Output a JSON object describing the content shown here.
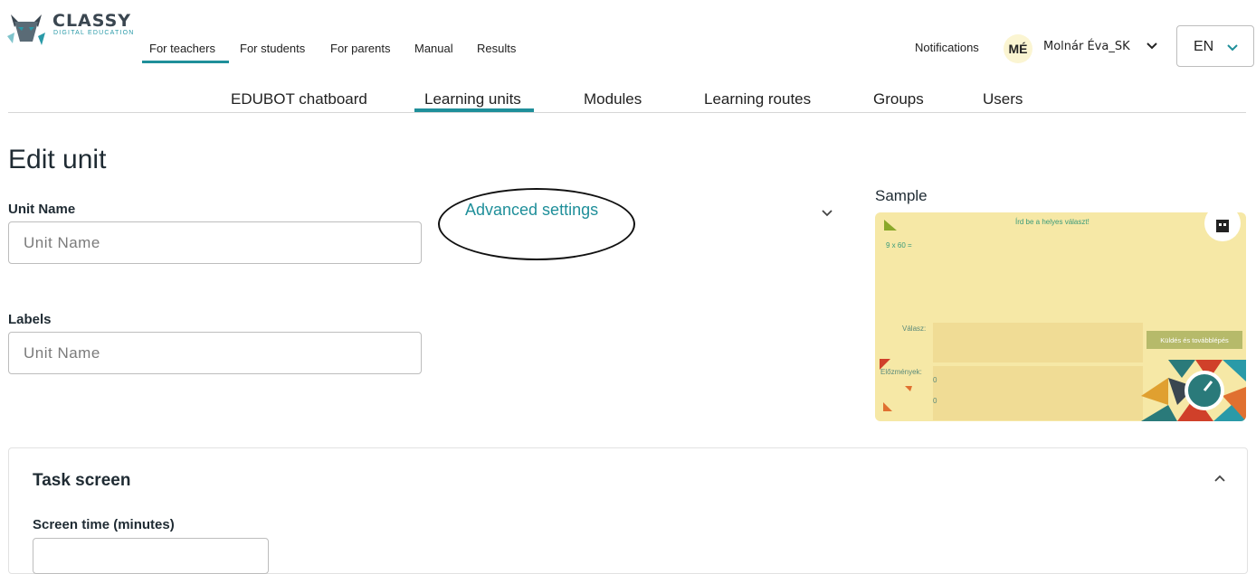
{
  "brand": {
    "name": "CLASSY",
    "tagline": "DIGITAL EDUCATION",
    "accent": "#1f8f9a"
  },
  "top_nav": {
    "items": [
      "For teachers",
      "For students",
      "For parents",
      "Manual",
      "Results"
    ],
    "active": "For teachers"
  },
  "user_area": {
    "notifications_label": "Notifications",
    "avatar_initials": "MÉ",
    "user_name": "Molnár Éva_SK",
    "language": "EN"
  },
  "sub_nav": {
    "items": [
      "EDUBOT chatboard",
      "Learning units",
      "Modules",
      "Learning routes",
      "Groups",
      "Users"
    ],
    "active": "Learning units"
  },
  "page": {
    "title": "Edit unit"
  },
  "form": {
    "unit_name_label": "Unit Name",
    "unit_name_placeholder": "Unit Name",
    "labels_label": "Labels",
    "labels_placeholder": "Unit Name",
    "advanced_settings_label": "Advanced settings"
  },
  "sample": {
    "label": "Sample",
    "instruction": "Írd be a helyes választ!",
    "question": "9 x 60 =",
    "answer_label": "Válasz:",
    "history_label": "Előzmények:",
    "history_values": [
      "0",
      "0"
    ],
    "submit_label": "Küldés és továbblépés"
  },
  "task_screen": {
    "title": "Task screen",
    "screen_time_label": "Screen time (minutes)"
  }
}
